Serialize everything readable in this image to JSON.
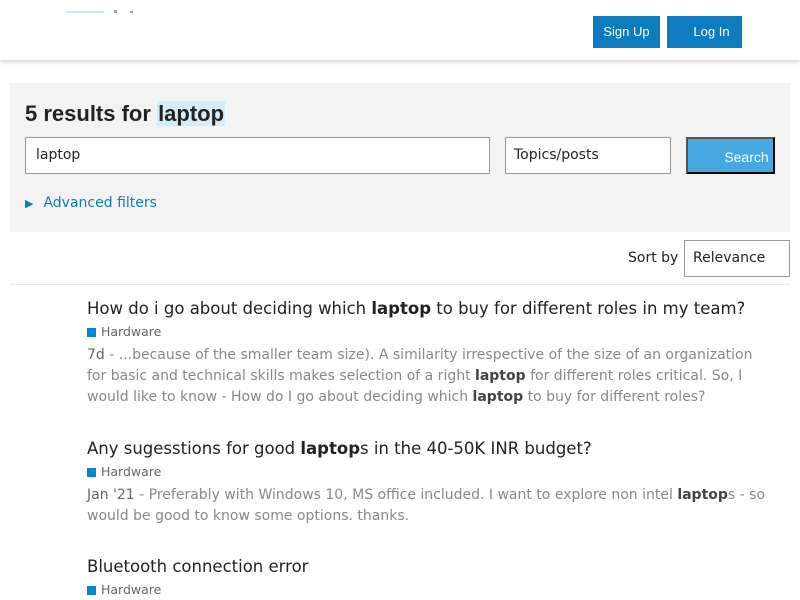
{
  "header": {
    "signup_label": "Sign Up",
    "login_label": "Log In"
  },
  "search": {
    "results_prefix": "5 results for",
    "results_term": "laptop",
    "query": "laptop",
    "type": "Topics/posts",
    "search_label": "Search",
    "advanced_label": "Advanced filters",
    "sort_label": "Sort by",
    "sort_value": "Relevance"
  },
  "results": [
    {
      "title_before": "How do i go about deciding which ",
      "title_bold": "laptop",
      "title_after": " to buy for different roles in my team?",
      "category": "Hardware",
      "date": "7d",
      "blurb_1": " - ...because of the smaller team size). A similarity irrespective of the size of an organization for basic and technical skills makes selection of a right ",
      "blurb_bold_1": "laptop",
      "blurb_2": " for different roles critical. So, I would like to know - How do I go about deciding which ",
      "blurb_bold_2": "laptop",
      "blurb_3": " to buy for different roles?"
    },
    {
      "title_before": "Any sugesstions for good ",
      "title_bold": "laptop",
      "title_after": "s in the 40-50K INR budget?",
      "category": "Hardware",
      "date": "Jan '21",
      "blurb_1": " - Preferably with Windows 10, MS office included. I want to explore non intel ",
      "blurb_bold_1": "laptop",
      "blurb_2": "s - so would be good to know some options. thanks."
    },
    {
      "title": "Bluetooth connection error",
      "category": "Hardware"
    }
  ],
  "colors": {
    "brand": "#0e7bbf",
    "search_button": "#47a7e0",
    "category_hardware": "#0088cc",
    "highlight": "#d5ecfb"
  }
}
